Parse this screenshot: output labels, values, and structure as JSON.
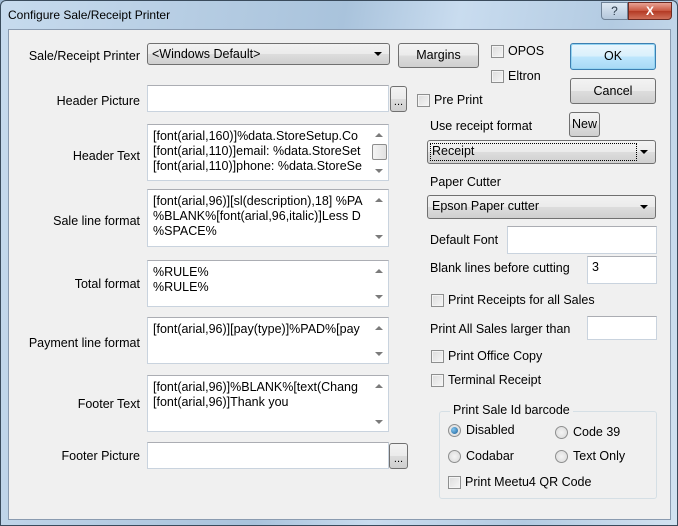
{
  "window": {
    "title": "Configure Sale/Receipt Printer",
    "help_label": "?",
    "close_label": "X"
  },
  "form": {
    "printer_label": "Sale/Receipt Printer",
    "printer_value": "<Windows Default>",
    "margins_label": "Margins",
    "opos_label": "OPOS",
    "eltron_label": "Eltron",
    "ok_label": "OK",
    "cancel_label": "Cancel",
    "header_picture_label": "Header Picture",
    "header_picture_value": "",
    "browse_label": "...",
    "pre_print_label": "Pre Print",
    "use_receipt_format_label": "Use receipt format",
    "new_label": "New",
    "receipt_format_value": "Receipt",
    "header_text_label": "Header Text",
    "header_text_value": "[font(arial,160)]%data.StoreSetup.Co\n[font(arial,110)]email: %data.StoreSet\n[font(arial,110)]phone: %data.StoreSe",
    "paper_cutter_label": "Paper Cutter",
    "paper_cutter_value": "Epson Paper cutter",
    "sale_line_label": "Sale line format",
    "sale_line_value": "[font(arial,96)][sl(description),18] %PA\n%BLANK%[font(arial,96,italic)]Less D\n%SPACE%",
    "default_font_label": "Default Font",
    "default_font_value": "",
    "blank_lines_label": "Blank lines before cutting",
    "blank_lines_value": "3",
    "total_format_label": "Total format",
    "total_format_value": "%RULE%\n%RULE%",
    "print_all_sales_checkbox_label": "Print Receipts for all Sales",
    "print_larger_than_label": "Print All Sales larger than",
    "print_larger_than_value": "",
    "payment_line_label": "Payment line format",
    "payment_line_value": "[font(arial,96)][pay(type)]%PAD%[pay",
    "print_office_copy_label": "Print Office Copy",
    "terminal_receipt_label": "Terminal Receipt",
    "footer_text_label": "Footer Text",
    "footer_text_value": "[font(arial,96)]%BLANK%[text(Chang\n[font(arial,96)]Thank you",
    "footer_picture_label": "Footer Picture",
    "footer_picture_value": ""
  },
  "barcode_group": {
    "legend": "Print Sale Id barcode",
    "options": [
      {
        "label": "Disabled",
        "selected": true
      },
      {
        "label": "Code 39",
        "selected": false
      },
      {
        "label": "Codabar",
        "selected": false
      },
      {
        "label": "Text Only",
        "selected": false
      }
    ],
    "qr_label": "Print Meetu4 QR Code"
  }
}
